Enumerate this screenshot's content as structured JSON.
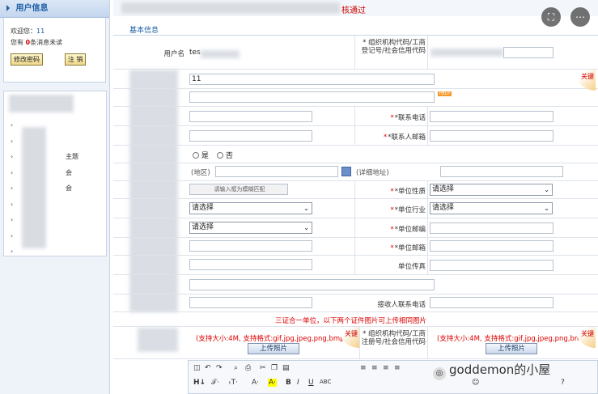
{
  "sidebar": {
    "panel_title": "用户信息",
    "welcome_prefix": "欢迎您：",
    "welcome_user": "11",
    "msg_prefix": "您有 ",
    "msg_count": "0",
    "msg_suffix": "条消息未读",
    "change_password": "修改密码",
    "logout": "注 销",
    "menu_items": [
      "",
      "",
      "主题",
      "会",
      "会",
      "",
      "",
      "",
      ""
    ]
  },
  "main": {
    "page_title": "核通过",
    "section_tab": "基本信息",
    "form": {
      "username_label": "用户名",
      "username_value": "tes",
      "org_code_label": "* 组织机构代码/工商登记号/社会信用代码",
      "name_value": "11",
      "key_badge": "关键",
      "help_badge": "HELP",
      "contact_phone_label": "*联系电话",
      "contact_email_label": "*联系人邮箱",
      "yes_label": "是",
      "no_label": "否",
      "district_label": "(地区)",
      "detail_address_label": "(详细地址)",
      "fuzzy_match_placeholder": "请输入框为模糊匹配",
      "unit_nature_label": "*单位性质",
      "unit_industry_label": "*单位行业",
      "unit_zip_label": "*单位邮编",
      "unit_email_label": "*单位邮箱",
      "unit_fax_label": "单位传真",
      "receiver_phone_label": "接收人联系电话",
      "select_placeholder": "请选择",
      "three_in_one_hint": "三证合一单位，以下两个证件图片可上传相同图片",
      "upload_hint": "(支持大小:4M, 支持格式:gif,jpg,jpeg,png,bmp)",
      "upload_button": "上传照片",
      "org_code_label2": "* 组织机构代码/工商注册号/社会信用代码"
    },
    "watermark": "goddemon的小屋"
  }
}
